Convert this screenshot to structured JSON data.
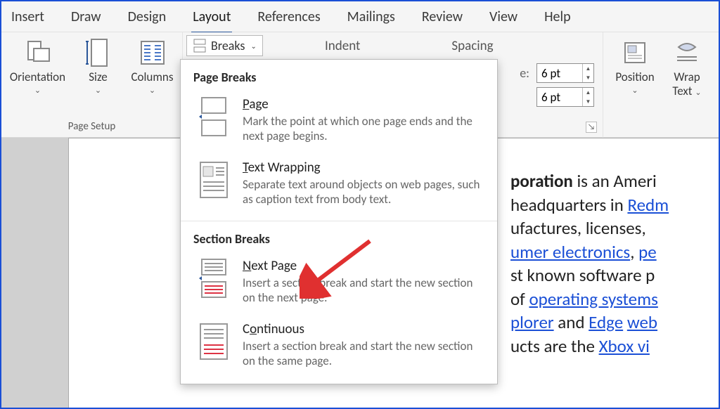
{
  "tabs": [
    "Insert",
    "Draw",
    "Design",
    "Layout",
    "References",
    "Mailings",
    "Review",
    "View",
    "Help"
  ],
  "active_tab_index": 3,
  "ribbon": {
    "page_setup_caption": "Page Setup",
    "orientation": "Orientation",
    "size": "Size",
    "columns": "Columns",
    "breaks": "Breaks",
    "position": "Position",
    "wrap_text_1": "Wrap",
    "wrap_text_2": "Text"
  },
  "indent_head": "Indent",
  "spacing_head": "Spacing",
  "spacing": {
    "before_label_suffix": "e:",
    "before_value": "6 pt",
    "after_value": "6 pt"
  },
  "breaks_menu": {
    "page_breaks_head": "Page Breaks",
    "section_breaks_head": "Section Breaks",
    "items": {
      "page": {
        "title_pre": "",
        "title_u": "P",
        "title_post": "age",
        "desc": "Mark the point at which one page ends and the next page begins."
      },
      "text_wrapping": {
        "title_pre": "",
        "title_u": "T",
        "title_post": "ext Wrapping",
        "desc": "Separate text around objects on web pages, such as caption text from body text."
      },
      "next_page": {
        "title_pre": "",
        "title_u": "N",
        "title_post": "ext Page",
        "desc": "Insert a section break and start the new section on the next page."
      },
      "continuous": {
        "title_pre": "C",
        "title_u": "o",
        "title_post": "ntinuous",
        "desc": "Insert a section break and start the new section on the same page."
      }
    }
  },
  "document": {
    "l1_a": "poration",
    "l1_b": " is an Ameri",
    "l2_a": "headquarters in ",
    "l2_link": "Redm",
    "l3": "ufactures, licenses,",
    "l4_link": "umer electronics",
    "l4_b": ", ",
    "l4_link2": "pe",
    "l5": "st known software p",
    "l6_a": "of ",
    "l6_link": "operating systems",
    "l7_link1": "plorer",
    "l7_mid": " and ",
    "l7_link2": "Edge",
    "l7_b": " ",
    "l7_link3": "web",
    "l8_a": "ucts are the ",
    "l8_link": "Xbox vi"
  }
}
